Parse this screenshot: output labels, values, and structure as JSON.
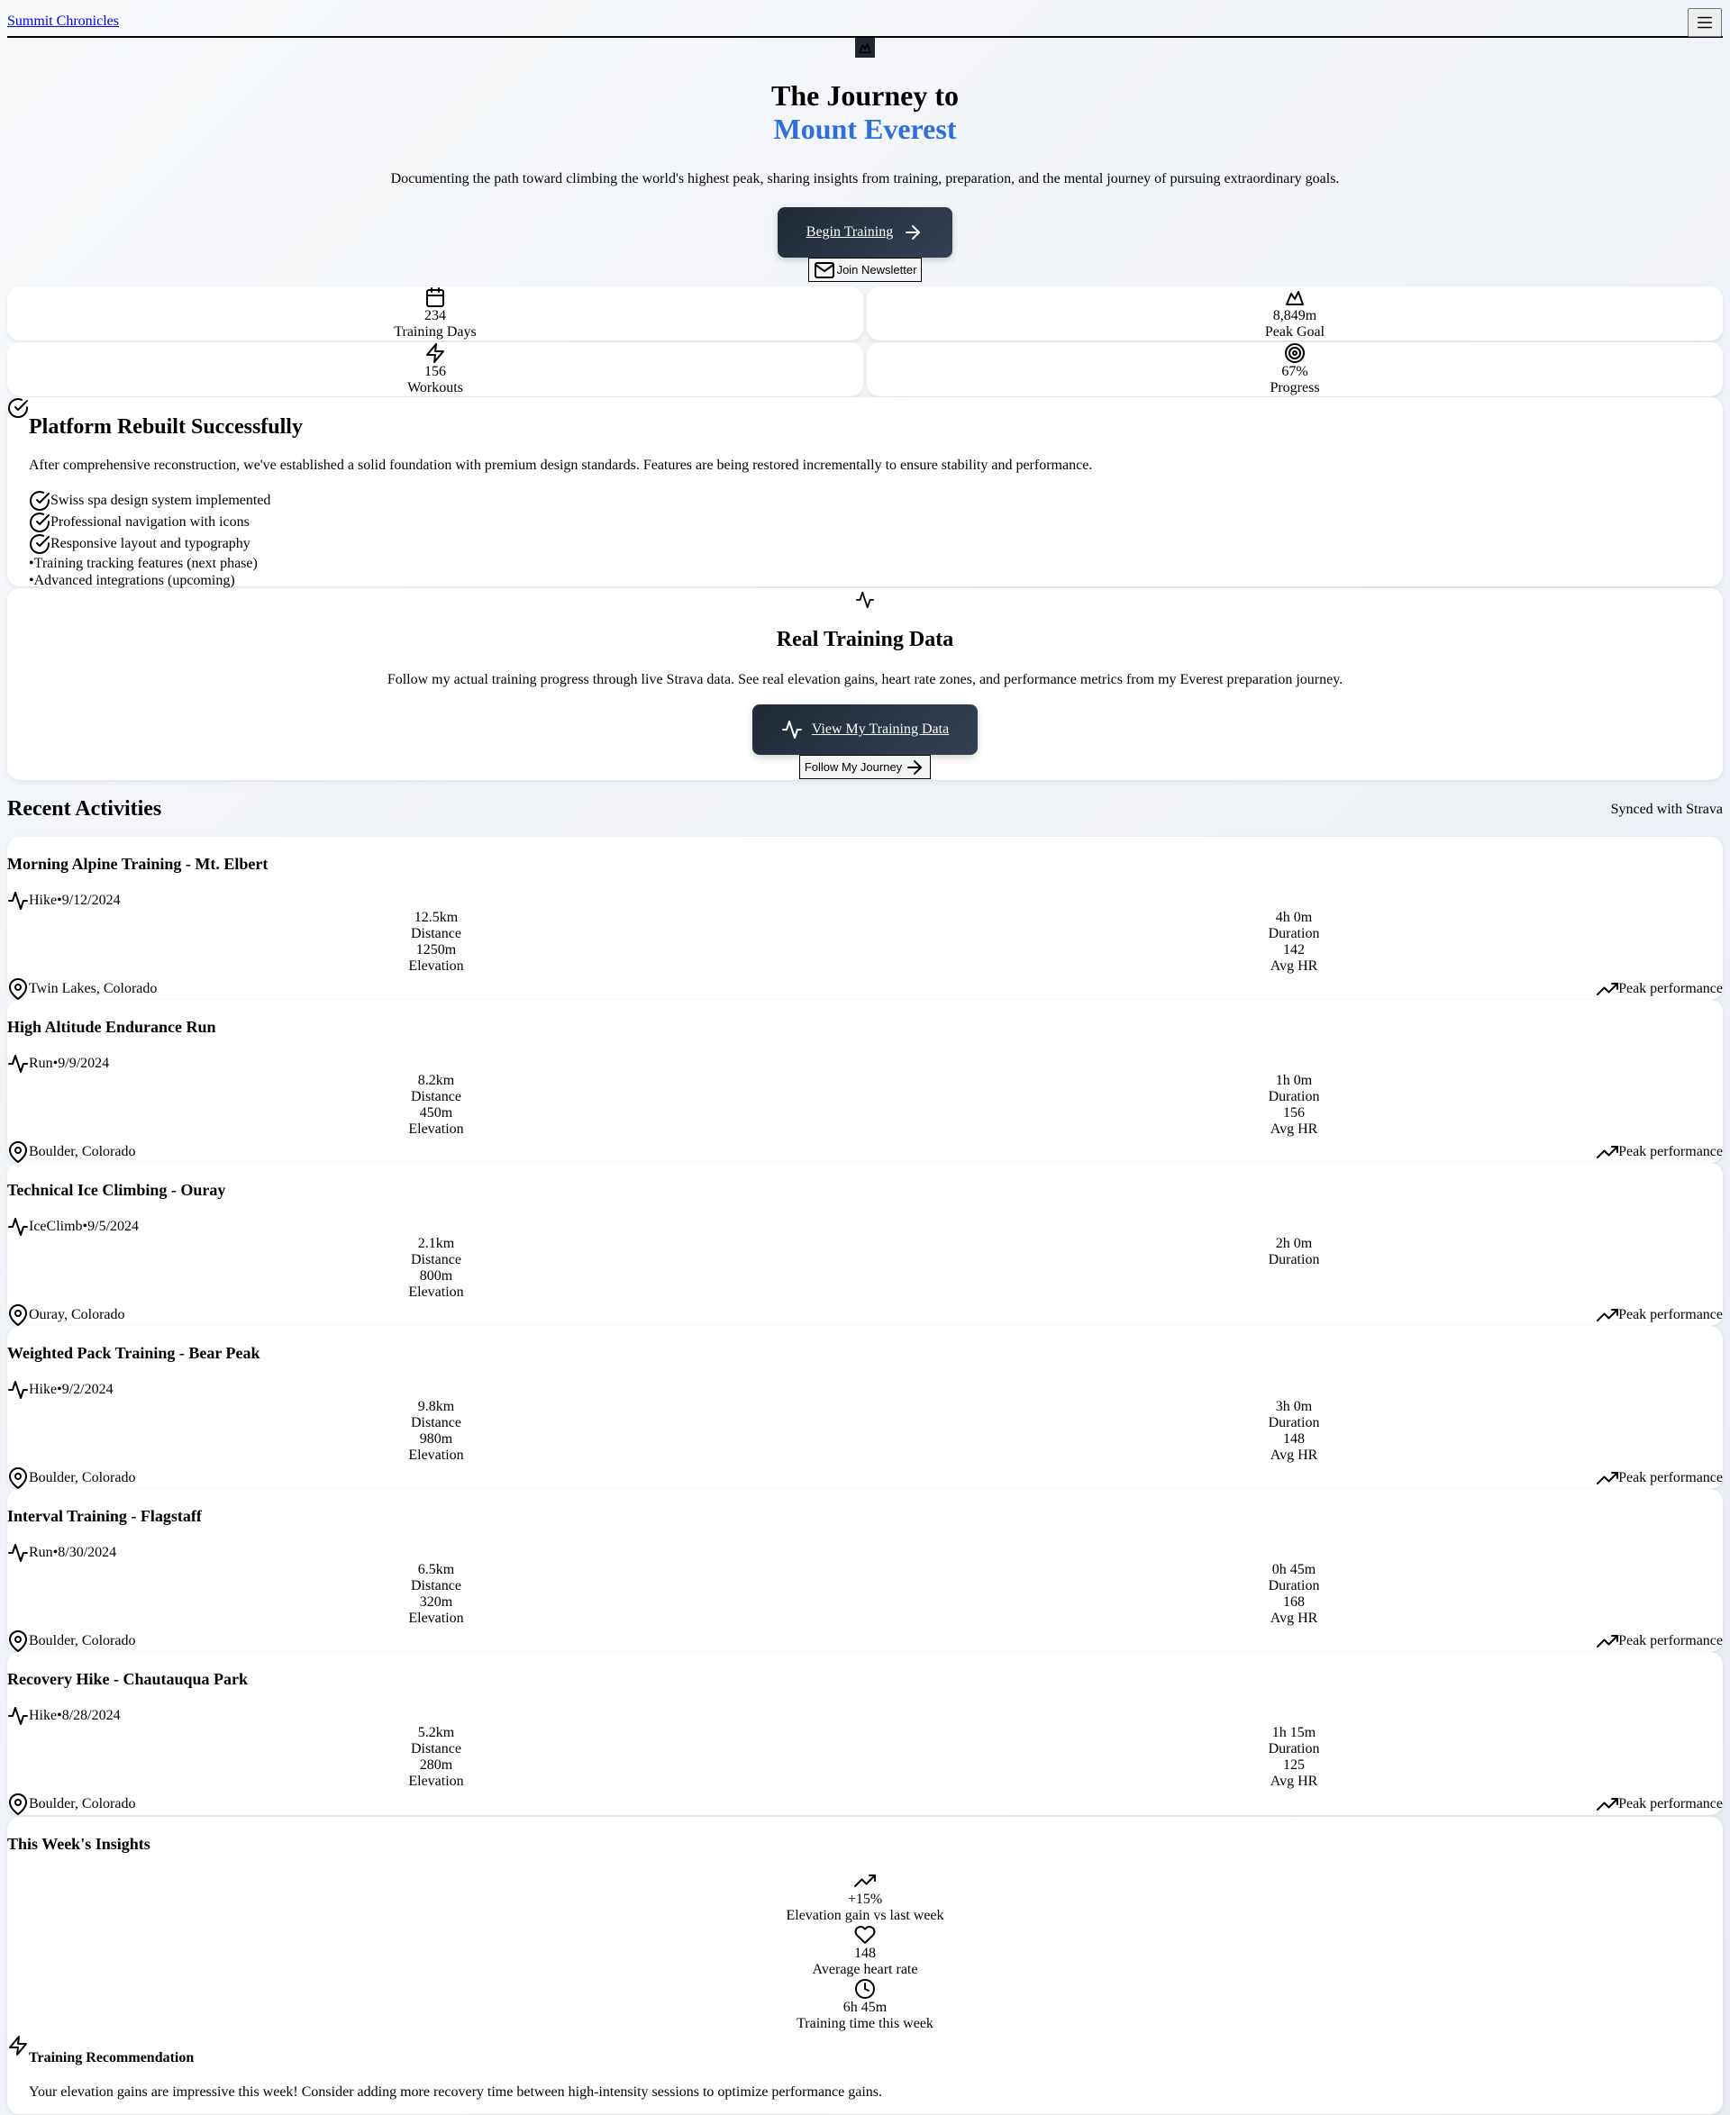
{
  "nav": {
    "brand": "Summit Chronicles",
    "menu_icon": "menu-icon"
  },
  "hero": {
    "logo_icon": "mountain-icon",
    "title_line1": "The Journey to",
    "title_line2": "Mount Everest",
    "accent_color": "#2f6fdc",
    "subtitle": "Documenting the path toward climbing the world's highest peak, sharing insights from training, preparation, and the mental journey of pursuing extraordinary goals.",
    "primary_button": "Begin Training",
    "secondary_button": "Join Newsletter"
  },
  "stats": [
    {
      "icon": "calendar-icon",
      "value": "234",
      "label": "Training Days"
    },
    {
      "icon": "mountain-icon",
      "value": "8,849m",
      "label": "Peak Goal"
    },
    {
      "icon": "zap-icon",
      "value": "156",
      "label": "Workouts"
    },
    {
      "icon": "target-icon",
      "value": "67%",
      "label": "Progress"
    }
  ],
  "rebuilt": {
    "title": "Platform Rebuilt Successfully",
    "description": "After comprehensive reconstruction, we've established a solid foundation with premium design standards. Features are being restored incrementally to ensure stability and performance.",
    "done": [
      "Swiss spa design system implemented",
      "Professional navigation with icons",
      "Responsive layout and typography"
    ],
    "upcoming": [
      "•Training tracking features (next phase)",
      "•Advanced integrations (upcoming)"
    ]
  },
  "strava": {
    "title": "Real Training Data",
    "description": "Follow my actual training progress through live Strava data. See real elevation gains, heart rate zones, and performance metrics from my Everest preparation journey.",
    "primary_button": "View My Training Data",
    "secondary_button": "Follow My Journey"
  },
  "activities_section": {
    "title": "Recent Activities",
    "sync_label": "Synced with Strava"
  },
  "activities": [
    {
      "title": "Morning Alpine Training - Mt. Elbert",
      "type": "Hike",
      "sep": "•",
      "date": "9/12/2024",
      "distance": "12.5km",
      "distance_label": "Distance",
      "elevation": "1250m",
      "elevation_label": "Elevation",
      "duration": "4h 0m",
      "duration_label": "Duration",
      "hr": "142",
      "hr_label": "Avg HR",
      "location": "Twin Lakes, Colorado",
      "badge": "Peak performance"
    },
    {
      "title": "High Altitude Endurance Run",
      "type": "Run",
      "sep": "•",
      "date": "9/9/2024",
      "distance": "8.2km",
      "distance_label": "Distance",
      "elevation": "450m",
      "elevation_label": "Elevation",
      "duration": "1h 0m",
      "duration_label": "Duration",
      "hr": "156",
      "hr_label": "Avg HR",
      "location": "Boulder, Colorado",
      "badge": "Peak performance"
    },
    {
      "title": "Technical Ice Climbing - Ouray",
      "type": "IceClimb",
      "sep": "•",
      "date": "9/5/2024",
      "distance": "2.1km",
      "distance_label": "Distance",
      "elevation": "800m",
      "elevation_label": "Elevation",
      "duration": "2h 0m",
      "duration_label": "Duration",
      "hr": "",
      "hr_label": "",
      "location": "Ouray, Colorado",
      "badge": "Peak performance"
    },
    {
      "title": "Weighted Pack Training - Bear Peak",
      "type": "Hike",
      "sep": "•",
      "date": "9/2/2024",
      "distance": "9.8km",
      "distance_label": "Distance",
      "elevation": "980m",
      "elevation_label": "Elevation",
      "duration": "3h 0m",
      "duration_label": "Duration",
      "hr": "148",
      "hr_label": "Avg HR",
      "location": "Boulder, Colorado",
      "badge": "Peak performance"
    },
    {
      "title": "Interval Training - Flagstaff",
      "type": "Run",
      "sep": "•",
      "date": "8/30/2024",
      "distance": "6.5km",
      "distance_label": "Distance",
      "elevation": "320m",
      "elevation_label": "Elevation",
      "duration": "0h 45m",
      "duration_label": "Duration",
      "hr": "168",
      "hr_label": "Avg HR",
      "location": "Boulder, Colorado",
      "badge": "Peak performance"
    },
    {
      "title": "Recovery Hike - Chautauqua Park",
      "type": "Hike",
      "sep": "•",
      "date": "8/28/2024",
      "distance": "5.2km",
      "distance_label": "Distance",
      "elevation": "280m",
      "elevation_label": "Elevation",
      "duration": "1h 15m",
      "duration_label": "Duration",
      "hr": "125",
      "hr_label": "Avg HR",
      "location": "Boulder, Colorado",
      "badge": "Peak performance"
    }
  ],
  "insights": {
    "title": "This Week's Insights",
    "items": [
      {
        "icon": "trending-up-icon",
        "value": "+15%",
        "label": "Elevation gain vs last week"
      },
      {
        "icon": "heart-icon",
        "value": "148",
        "label": "Average heart rate"
      },
      {
        "icon": "clock-icon",
        "value": "6h 45m",
        "label": "Training time this week"
      }
    ],
    "recommendation_title": "Training Recommendation",
    "recommendation_text": "Your elevation gains are impressive this week! Consider adding more recovery time between high-intensity sessions to optimize performance gains."
  }
}
